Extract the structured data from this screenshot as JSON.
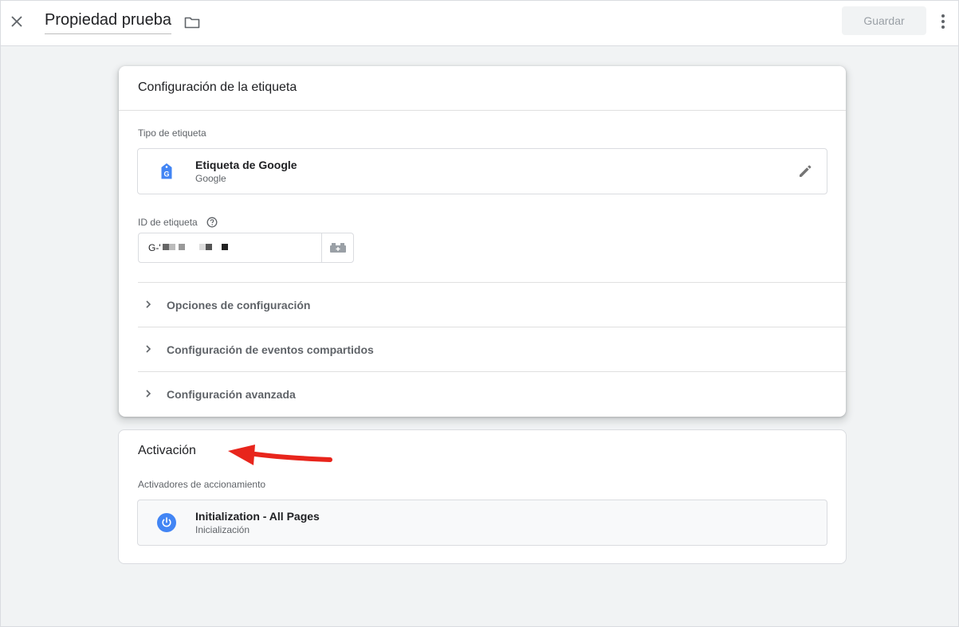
{
  "header": {
    "title": "Propiedad prueba",
    "save_label": "Guardar"
  },
  "config_card": {
    "title": "Configuración de la etiqueta",
    "tag_type_label": "Tipo de etiqueta",
    "tag_type": {
      "name": "Etiqueta de Google",
      "vendor": "Google",
      "icon": "google-tag-icon"
    },
    "tag_id_label": "ID de etiqueta",
    "tag_id_value": "G-'",
    "sections": [
      {
        "label": "Opciones de configuración"
      },
      {
        "label": "Configuración de eventos compartidos"
      },
      {
        "label": "Configuración avanzada"
      }
    ]
  },
  "trigger_card": {
    "title": "Activación",
    "triggers_label": "Activadores de accionamiento",
    "trigger": {
      "name": "Initialization - All Pages",
      "type": "Inicialización",
      "icon": "power-icon"
    }
  },
  "colors": {
    "accent_blue": "#4285f4",
    "annotation_arrow": "#e8251c",
    "background": "#f1f3f4"
  }
}
